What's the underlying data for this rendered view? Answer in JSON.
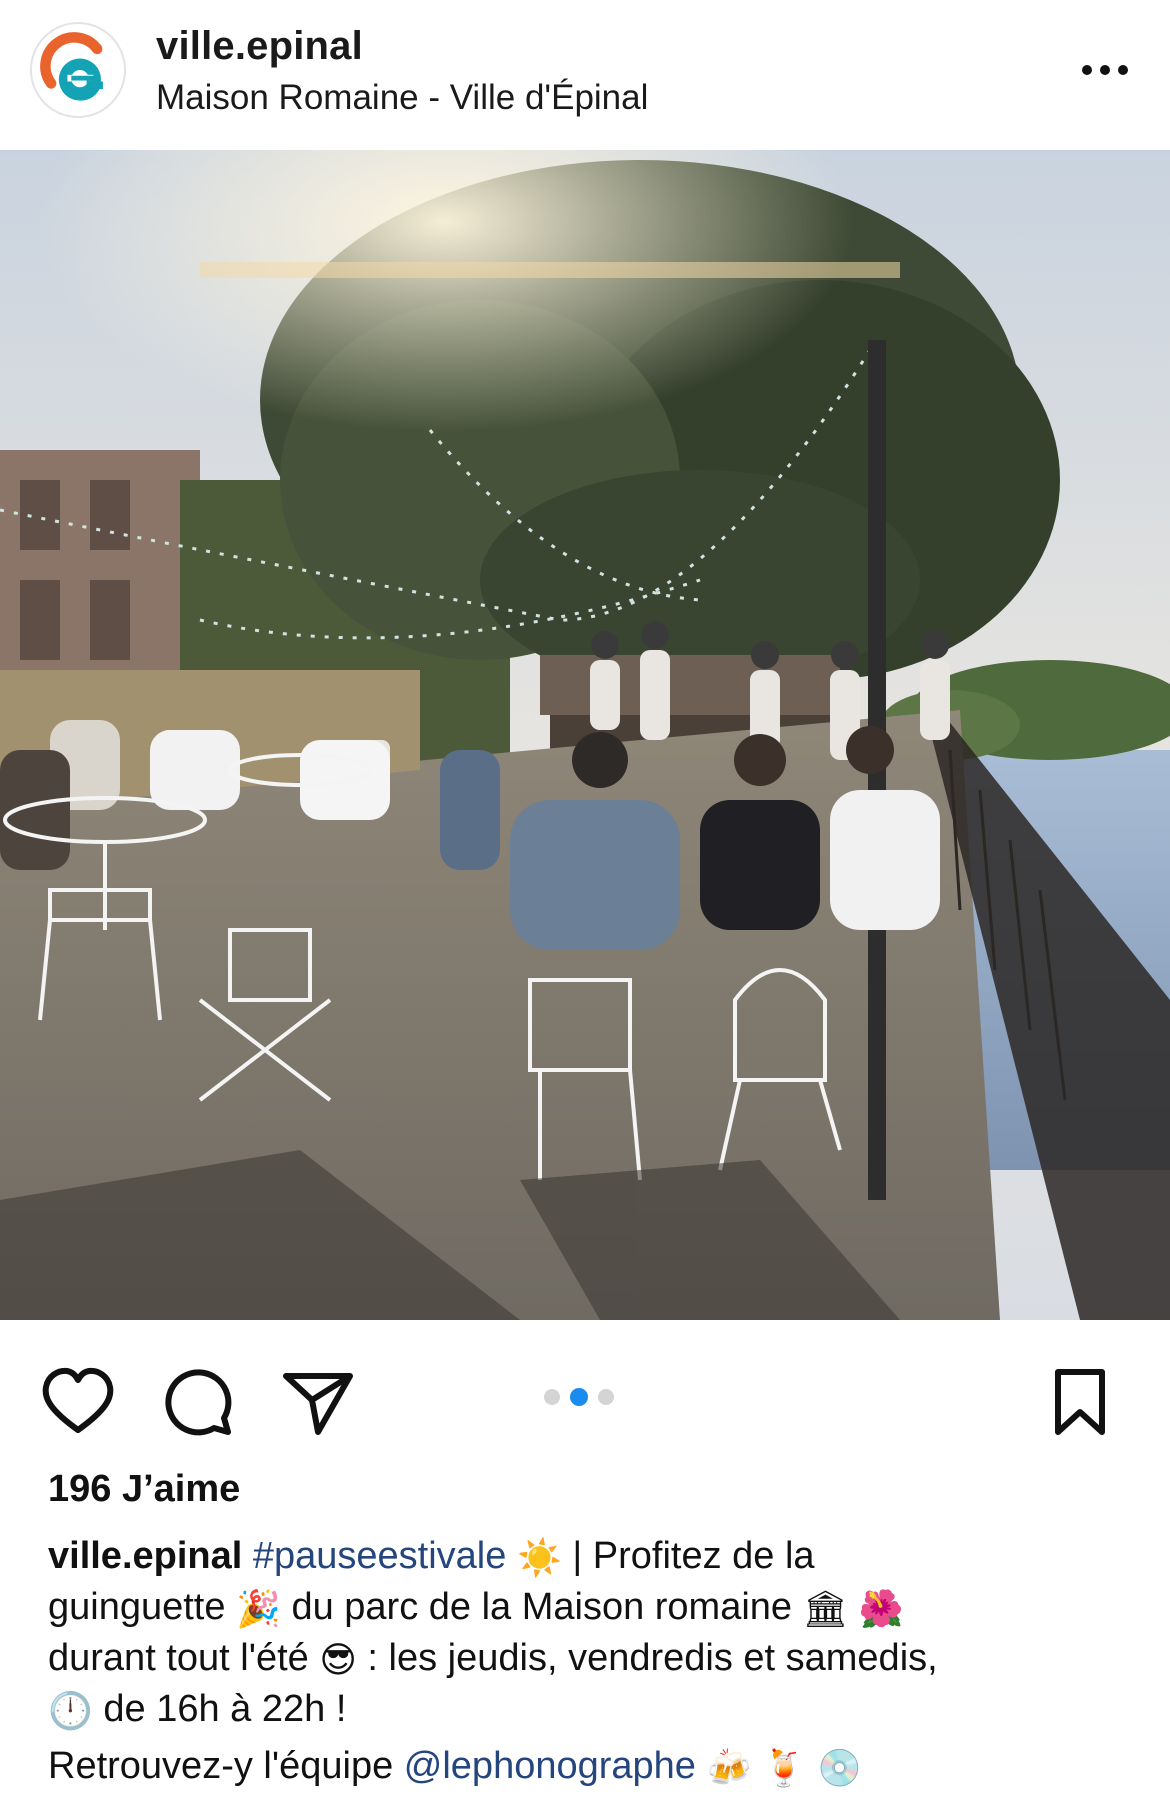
{
  "header": {
    "account": "ville.epinal",
    "location": "Maison Romaine - Ville d'Épinal",
    "avatar_icon": "epinal-e-logo-icon",
    "more_icon": "more-horizontal-icon"
  },
  "post": {
    "photo_description_icon": "guinguette-photo",
    "carousel": {
      "count": 3,
      "active": 2
    }
  },
  "actions": {
    "like_icon": "heart-icon",
    "comment_icon": "comment-bubble-icon",
    "share_icon": "paper-plane-icon",
    "save_icon": "bookmark-icon"
  },
  "likes": "196 J’aime",
  "caption": {
    "user": "ville.epinal",
    "hashtag": "#pauseestivale",
    "sun_emoji": "☀️",
    "text1": " | Profitez de la",
    "text2a": "guinguette ",
    "party_emoji": "🎉",
    "text2b": " du parc de la Maison romaine ",
    "building_emoji": "🏛",
    "flower_emoji": "🌺",
    "text3a": "durant tout l'été ",
    "sunglasses_emoji": "😎",
    "text3b": " : les jeudis, vendredis et samedis,",
    "clock_emoji": "🕛",
    "text4": " de 16h à 22h !",
    "text5a": "Retrouvez-y l'équipe ",
    "mention": "@lephonographe",
    "beer_emoji": "🍻",
    "cocktail_emoji": "🍹",
    "disc_emoji": "💿"
  },
  "colors": {
    "link": "#24457e",
    "active_dot": "#1a8cf0",
    "logo_orange": "#e8642c",
    "logo_teal": "#14a3b5"
  }
}
